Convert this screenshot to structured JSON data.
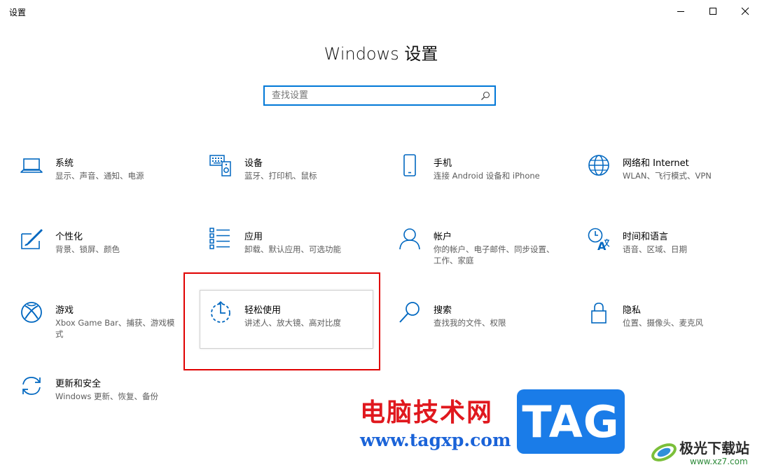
{
  "window": {
    "title": "设置",
    "controls": {
      "minimize": "minimize-icon",
      "maximize": "maximize-icon",
      "close": "close-icon"
    }
  },
  "page": {
    "title": "Windows 设置"
  },
  "search": {
    "placeholder": "查找设置",
    "value": ""
  },
  "tiles": [
    {
      "title": "系统",
      "desc": "显示、声音、通知、电源",
      "icon": "laptop-icon"
    },
    {
      "title": "设备",
      "desc": "蓝牙、打印机、鼠标",
      "icon": "keyboard-speaker-icon"
    },
    {
      "title": "手机",
      "desc": "连接 Android 设备和 iPhone",
      "icon": "phone-icon"
    },
    {
      "title": "网络和 Internet",
      "desc": "WLAN、飞行模式、VPN",
      "icon": "globe-icon"
    },
    {
      "title": "个性化",
      "desc": "背景、锁屏、颜色",
      "icon": "paint-icon"
    },
    {
      "title": "应用",
      "desc": "卸载、默认应用、可选功能",
      "icon": "apps-list-icon"
    },
    {
      "title": "帐户",
      "desc": "你的帐户、电子邮件、同步设置、工作、家庭",
      "icon": "person-icon"
    },
    {
      "title": "时间和语言",
      "desc": "语音、区域、日期",
      "icon": "time-language-icon"
    },
    {
      "title": "游戏",
      "desc": "Xbox Game Bar、捕获、游戏模式",
      "icon": "xbox-icon"
    },
    {
      "title": "轻松使用",
      "desc": "讲述人、放大镜、高对比度",
      "icon": "ease-of-access-icon"
    },
    {
      "title": "搜索",
      "desc": "查找我的文件、权限",
      "icon": "search-icon"
    },
    {
      "title": "隐私",
      "desc": "位置、摄像头、麦克风",
      "icon": "lock-icon"
    },
    {
      "title": "更新和安全",
      "desc": "Windows 更新、恢复、备份",
      "icon": "sync-icon"
    }
  ],
  "watermark": {
    "site_name": "电脑技术网",
    "site_url": "www.tagxp.com",
    "badge": "TAG",
    "logo_text": "极光下载站",
    "logo_url": "www.xz7.com"
  },
  "colors": {
    "accent": "#0078d7",
    "highlight_frame": "#e00000"
  }
}
